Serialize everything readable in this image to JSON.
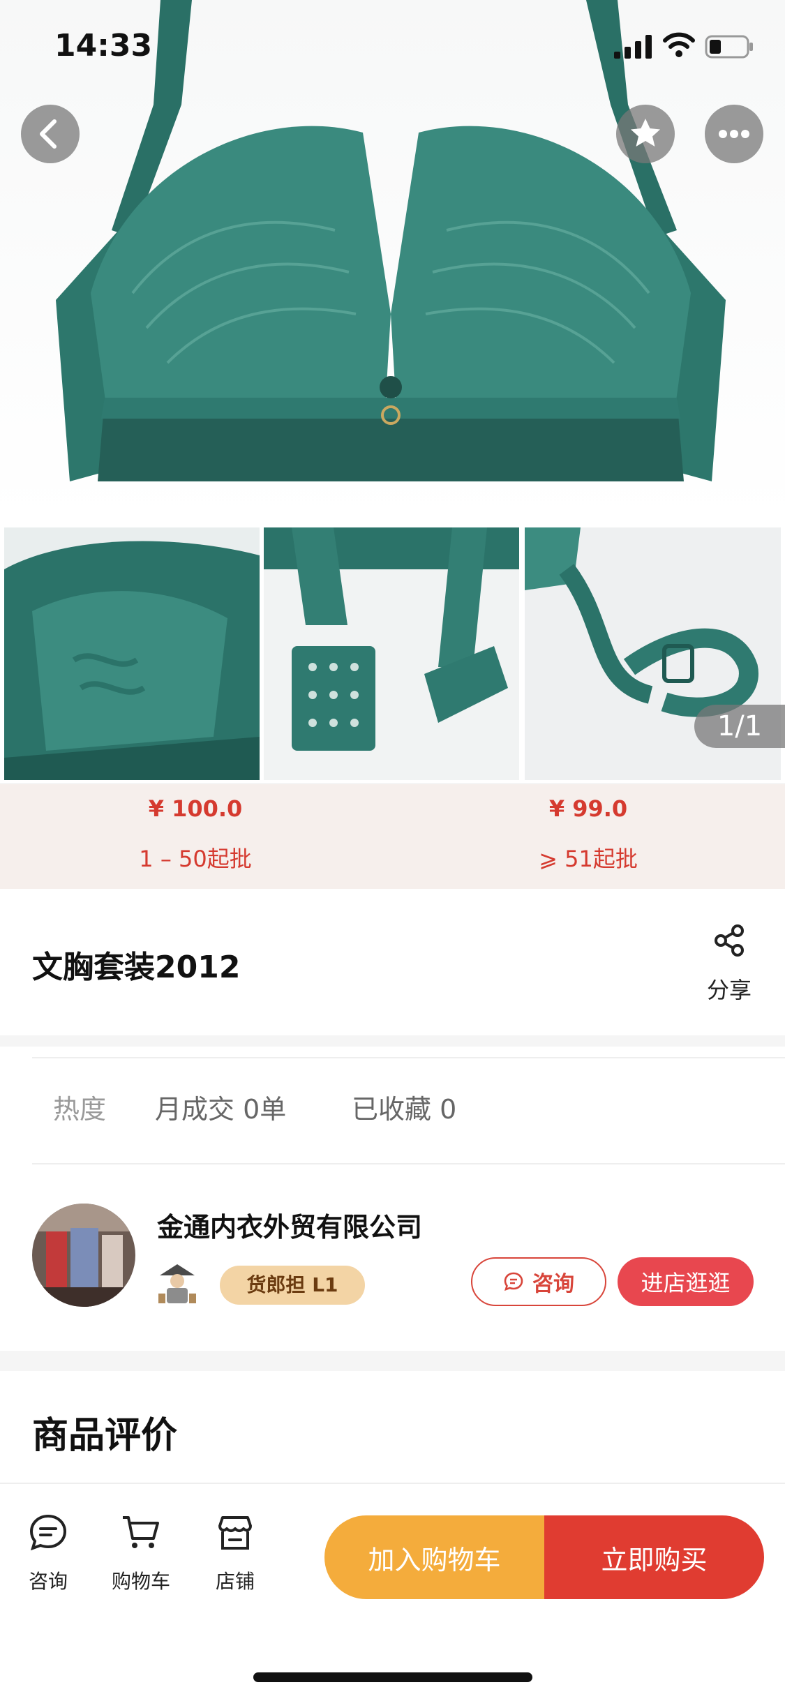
{
  "status_bar": {
    "time": "14:33"
  },
  "gallery": {
    "page_indicator": "1/1"
  },
  "price_tiers": [
    {
      "price": "¥ 100.0",
      "quantity": "1 – 50起批"
    },
    {
      "price": "¥ 99.0",
      "quantity": "⩾ 51起批"
    }
  ],
  "product": {
    "title": "文胸套装2012",
    "share_label": "分享"
  },
  "stats": {
    "heat_label": "热度",
    "monthly_sales": "月成交 0单",
    "favorites": "已收藏 0"
  },
  "store": {
    "name": "金通内衣外贸有限公司",
    "level_badge": "货郎担 L1",
    "consult_label": "咨询",
    "visit_label": "进店逛逛"
  },
  "reviews": {
    "title": "商品评价"
  },
  "bottom_nav": {
    "consult_label": "咨询",
    "cart_label": "购物车",
    "store_label": "店铺",
    "add_to_cart_label": "加入购物车",
    "buy_now_label": "立即购买"
  },
  "colors": {
    "accent_red": "#e03c31",
    "accent_orange": "#f4ac3c",
    "price_red": "#d53a2f",
    "product_teal": "#2f7a70"
  },
  "icons": [
    "back-icon",
    "star-icon",
    "more-icon",
    "share-icon",
    "chat-icon",
    "cart-icon",
    "store-icon"
  ]
}
